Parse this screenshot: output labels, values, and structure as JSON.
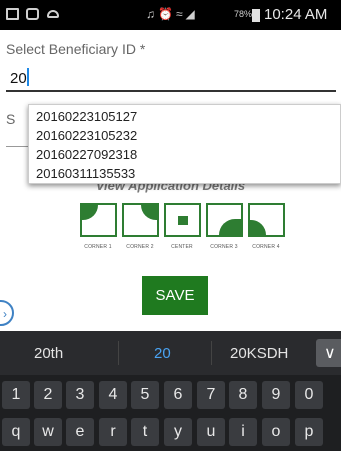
{
  "status_bar": {
    "icons": [
      "gallery-icon",
      "message-icon",
      "voicemail-icon",
      "mute-icon",
      "alarm-icon",
      "wifi-icon",
      "signal-icon",
      "battery-icon"
    ],
    "battery": "78%",
    "time": "10:24 AM"
  },
  "form": {
    "beneficiary_label": "Select Beneficiary ID *",
    "beneficiary_value": "20",
    "hidden_label_fragment": "S",
    "suggestions": [
      "20160223105127",
      "20160223105232",
      "20160227092318",
      "20160311135533"
    ],
    "section_heading": "View Application Details",
    "corners": [
      "CORNER 1",
      "CORNER 2",
      "CENTER",
      "CORNER 3",
      "CORNER 4"
    ],
    "save_label": "SAVE"
  },
  "keyboard": {
    "suggestions": [
      "20th",
      "20",
      "20KSDH"
    ],
    "collapse_icon": "chevron-down-icon",
    "number_row": [
      "1",
      "2",
      "3",
      "4",
      "5",
      "6",
      "7",
      "8",
      "9",
      "0"
    ],
    "letter_row": [
      "q",
      "w",
      "e",
      "r",
      "t",
      "y",
      "u",
      "i",
      "o",
      "p"
    ]
  },
  "colors": {
    "accent_green": "#1f7a1f",
    "corner_green": "#2e7d32",
    "keyboard_bg": "#1e1f21",
    "suggestion_highlight": "#4aa3f2"
  }
}
